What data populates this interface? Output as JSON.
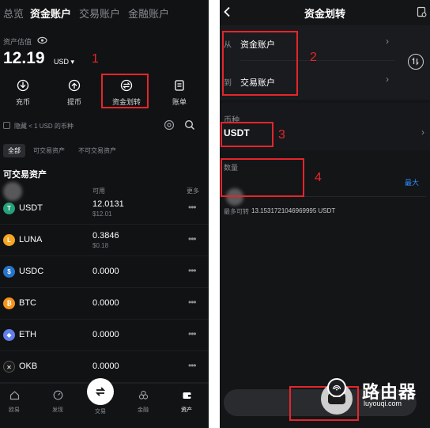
{
  "left": {
    "tabs": [
      "总览",
      "资金账户",
      "交易账户",
      "金融账户"
    ],
    "assets_label": "资产估值",
    "balance": "12.19",
    "currency": "USD",
    "actions": [
      "充币",
      "提币",
      "资金划转",
      "账单"
    ],
    "hide_small": "隐藏 < 1 USD 的币种",
    "filters": [
      "全部",
      "可交易资产",
      "不可交易资产"
    ],
    "section_title": "可交易资产",
    "columns": {
      "available": "可用",
      "more": "更多"
    },
    "coins": [
      {
        "name": "USDT",
        "amount": "12.0131",
        "usd": "$12.01",
        "color": "#26a17b",
        "glyph": "T"
      },
      {
        "name": "LUNA",
        "amount": "0.3846",
        "usd": "$0.18",
        "color": "#f5a623",
        "glyph": "L"
      },
      {
        "name": "USDC",
        "amount": "0.0000",
        "usd": "",
        "color": "#2775ca",
        "glyph": "$"
      },
      {
        "name": "BTC",
        "amount": "0.0000",
        "usd": "",
        "color": "#f7931a",
        "glyph": "₿"
      },
      {
        "name": "ETH",
        "amount": "0.0000",
        "usd": "",
        "color": "#627eea",
        "glyph": "◆"
      },
      {
        "name": "OKB",
        "amount": "0.0000",
        "usd": "",
        "color": "#1a1a1a",
        "glyph": "✕"
      }
    ],
    "nav": [
      "欧易",
      "发现",
      "交易",
      "金融",
      "资产"
    ],
    "annotation": "1"
  },
  "right": {
    "title": "资金划转",
    "from_label": "从",
    "from_value": "资金账户",
    "to_label": "到",
    "to_value": "交易账户",
    "currency_label": "币种",
    "currency_value": "USDT",
    "amount_label": "数量",
    "max_label": "最大",
    "max_transfer_label": "最多可转",
    "max_transfer_value": "13.1531721046969995 USDT",
    "annotations": [
      "2",
      "3",
      "4"
    ]
  },
  "watermark": {
    "cn": "路由器",
    "en": "luyouqi.com"
  },
  "colors": {
    "accent": "#2d8cff",
    "annotation_red": "#e6252b",
    "bg": "#111214"
  }
}
